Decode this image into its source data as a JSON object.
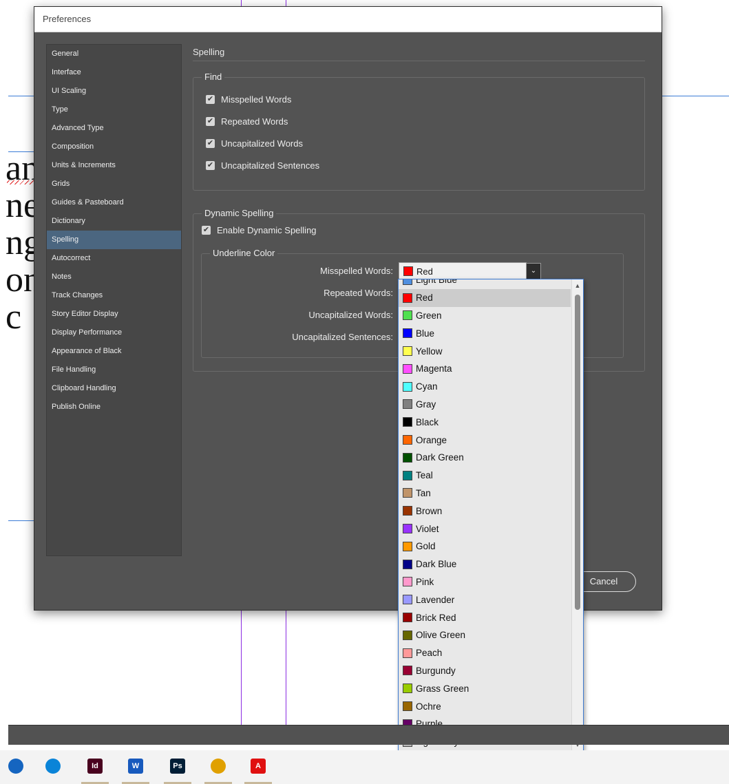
{
  "dialog": {
    "title": "Preferences"
  },
  "sidebar": {
    "items": [
      {
        "label": "General"
      },
      {
        "label": "Interface"
      },
      {
        "label": "UI Scaling"
      },
      {
        "label": "Type"
      },
      {
        "label": "Advanced Type"
      },
      {
        "label": "Composition"
      },
      {
        "label": "Units & Increments"
      },
      {
        "label": "Grids"
      },
      {
        "label": "Guides & Pasteboard"
      },
      {
        "label": "Dictionary"
      },
      {
        "label": "Spelling"
      },
      {
        "label": "Autocorrect"
      },
      {
        "label": "Notes"
      },
      {
        "label": "Track Changes"
      },
      {
        "label": "Story Editor Display"
      },
      {
        "label": "Display Performance"
      },
      {
        "label": "Appearance of Black"
      },
      {
        "label": "File Handling"
      },
      {
        "label": "Clipboard Handling"
      },
      {
        "label": "Publish Online"
      }
    ],
    "selected": "Spelling"
  },
  "spelling": {
    "title": "Spelling",
    "find": {
      "label": "Find",
      "options": [
        {
          "label": "Misspelled Words",
          "checked": true
        },
        {
          "label": "Repeated Words",
          "checked": true
        },
        {
          "label": "Uncapitalized Words",
          "checked": true
        },
        {
          "label": "Uncapitalized Sentences",
          "checked": true
        }
      ]
    },
    "dynamic": {
      "label": "Dynamic Spelling",
      "enable_label": "Enable Dynamic Spelling",
      "enable_checked": true,
      "underline": {
        "label": "Underline Color",
        "fields": [
          {
            "label": "Misspelled Words:"
          },
          {
            "label": "Repeated Words:"
          },
          {
            "label": "Uncapitalized Words:"
          },
          {
            "label": "Uncapitalized Sentences:"
          }
        ],
        "selected_value": "Red",
        "selected_color": "#ff0000"
      }
    },
    "cancel_label": "Cancel",
    "checkmark": "✔"
  },
  "color_options": [
    {
      "label": "Light Blue",
      "color": "#4f8fe0"
    },
    {
      "label": "Red",
      "color": "#ff0000"
    },
    {
      "label": "Green",
      "color": "#4fe04f"
    },
    {
      "label": "Blue",
      "color": "#0000ff"
    },
    {
      "label": "Yellow",
      "color": "#ffff4f"
    },
    {
      "label": "Magenta",
      "color": "#ff4fff"
    },
    {
      "label": "Cyan",
      "color": "#4fffff"
    },
    {
      "label": "Gray",
      "color": "#808080"
    },
    {
      "label": "Black",
      "color": "#000000"
    },
    {
      "label": "Orange",
      "color": "#ff6600"
    },
    {
      "label": "Dark Green",
      "color": "#005000"
    },
    {
      "label": "Teal",
      "color": "#008080"
    },
    {
      "label": "Tan",
      "color": "#c0946a"
    },
    {
      "label": "Brown",
      "color": "#993300"
    },
    {
      "label": "Violet",
      "color": "#9933ff"
    },
    {
      "label": "Gold",
      "color": "#ff9900"
    },
    {
      "label": "Dark Blue",
      "color": "#000087"
    },
    {
      "label": "Pink",
      "color": "#ff99cc"
    },
    {
      "label": "Lavender",
      "color": "#9999ff"
    },
    {
      "label": "Brick Red",
      "color": "#990000"
    },
    {
      "label": "Olive Green",
      "color": "#666600"
    },
    {
      "label": "Peach",
      "color": "#ff9999"
    },
    {
      "label": "Burgundy",
      "color": "#990033"
    },
    {
      "label": "Grass Green",
      "color": "#99cc00"
    },
    {
      "label": "Ochre",
      "color": "#996600"
    },
    {
      "label": "Purple",
      "color": "#660066"
    },
    {
      "label": "Light Gray",
      "color": "#bababa"
    }
  ],
  "highlighted_option": "Red",
  "doc_text": [
    "an",
    "ne",
    "ng",
    "on",
    "c"
  ],
  "taskbar": {
    "apps": [
      {
        "name": "mail-icon",
        "color": "#1565c0",
        "label": ""
      },
      {
        "name": "edge-icon",
        "color": "#0a84d8",
        "label": ""
      },
      {
        "name": "indesign-icon",
        "color": "#49021f",
        "label": "Id"
      },
      {
        "name": "word-icon",
        "color": "#185abd",
        "label": "W"
      },
      {
        "name": "photoshop-icon",
        "color": "#001e36",
        "label": "Ps"
      },
      {
        "name": "chrome-icon",
        "color": "#e0a000",
        "label": ""
      },
      {
        "name": "acrobat-icon",
        "color": "#e01010",
        "label": "A"
      }
    ]
  }
}
